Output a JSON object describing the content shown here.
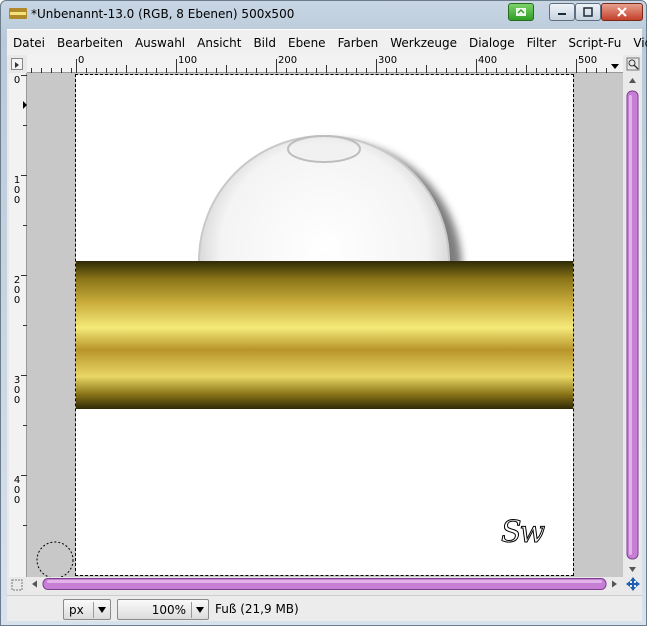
{
  "window": {
    "title": "*Unbenannt-13.0 (RGB, 8 Ebenen) 500x500"
  },
  "menubar": {
    "items": [
      "Datei",
      "Bearbeiten",
      "Auswahl",
      "Ansicht",
      "Bild",
      "Ebene",
      "Farben",
      "Werkzeuge",
      "Dialoge",
      "Filter",
      "Script-Fu",
      "Video"
    ]
  },
  "rulers": {
    "horizontal": [
      "0",
      "100",
      "200",
      "300",
      "400",
      "500"
    ],
    "vertical": [
      "0",
      "100",
      "200",
      "300",
      "400"
    ]
  },
  "canvas": {
    "signature": "Sw"
  },
  "statusbar": {
    "unit": "px",
    "zoom": "100%",
    "status": "Fuß (21,9 MB)"
  },
  "colors": {
    "scrollbar_accent": "#c77fd6",
    "gold_light": "#f4ea7a",
    "gold_mid": "#b8952a",
    "gold_dark": "#2d2a05"
  },
  "icons": [
    "app-icon",
    "window-status-icon",
    "minimize-icon",
    "maximize-icon",
    "close-icon",
    "navigate-icon",
    "quick-mask-icon",
    "chevron-down-icon"
  ]
}
